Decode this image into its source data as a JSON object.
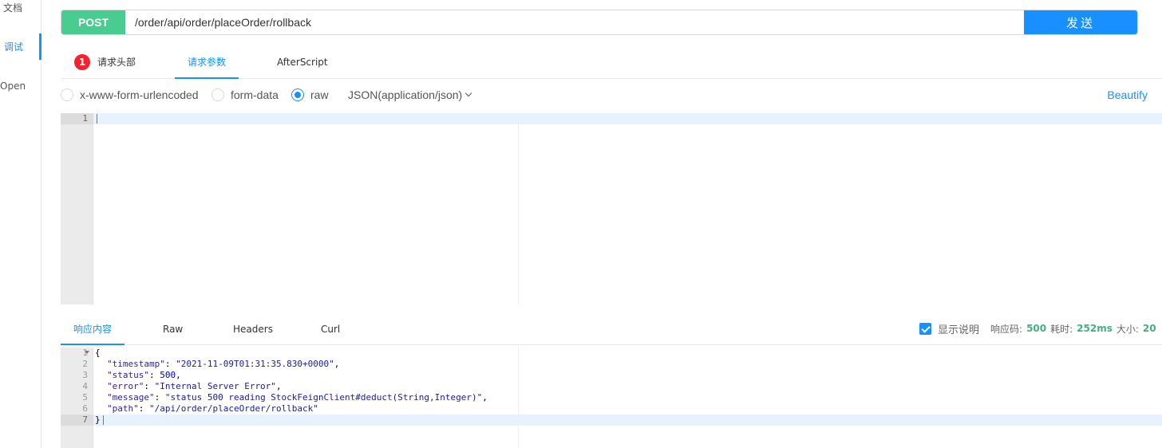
{
  "sidebar": {
    "items": [
      {
        "label": "文档"
      },
      {
        "label": "调试"
      },
      {
        "label": "Open"
      }
    ]
  },
  "request": {
    "method": "POST",
    "url": "/order/api/order/placeOrder/rollback",
    "send_label": "发送"
  },
  "req_tabs": {
    "headers_badge": "1",
    "headers_label": "请求头部",
    "params_label": "请求参数",
    "afterscript_label": "AfterScript"
  },
  "body_types": {
    "urlencoded": "x-www-form-urlencoded",
    "formdata": "form-data",
    "raw": "raw",
    "content_type": "JSON(application/json)",
    "beautify": "Beautify"
  },
  "request_editor": {
    "lines": [
      "1"
    ]
  },
  "resp_tabs": {
    "content": "响应内容",
    "raw": "Raw",
    "headers": "Headers",
    "curl": "Curl"
  },
  "resp_meta": {
    "show_desc": "显示说明",
    "code_label": "响应码:",
    "code_value": "500",
    "time_label": "耗时:",
    "time_value": "252ms",
    "size_label": "大小:",
    "size_value": "20"
  },
  "response_editor": {
    "line_numbers": [
      "1",
      "2",
      "3",
      "4",
      "5",
      "6",
      "7"
    ],
    "open_brace": "{",
    "close_brace": "}",
    "fields": [
      {
        "key": "\"timestamp\"",
        "value": "\"2021-11-09T01:31:35.830+0000\""
      },
      {
        "key": "\"status\"",
        "value": "500"
      },
      {
        "key": "\"error\"",
        "value": "\"Internal Server Error\""
      },
      {
        "key": "\"message\"",
        "value": "\"status 500 reading StockFeignClient#deduct(String,Integer)\""
      },
      {
        "key": "\"path\"",
        "value": "\"/api/order/placeOrder/rollback\""
      }
    ]
  },
  "colors": {
    "accent": "#1890ff",
    "post": "#49cc90",
    "badge": "#f5222d",
    "success_text": "#3fb27f"
  }
}
